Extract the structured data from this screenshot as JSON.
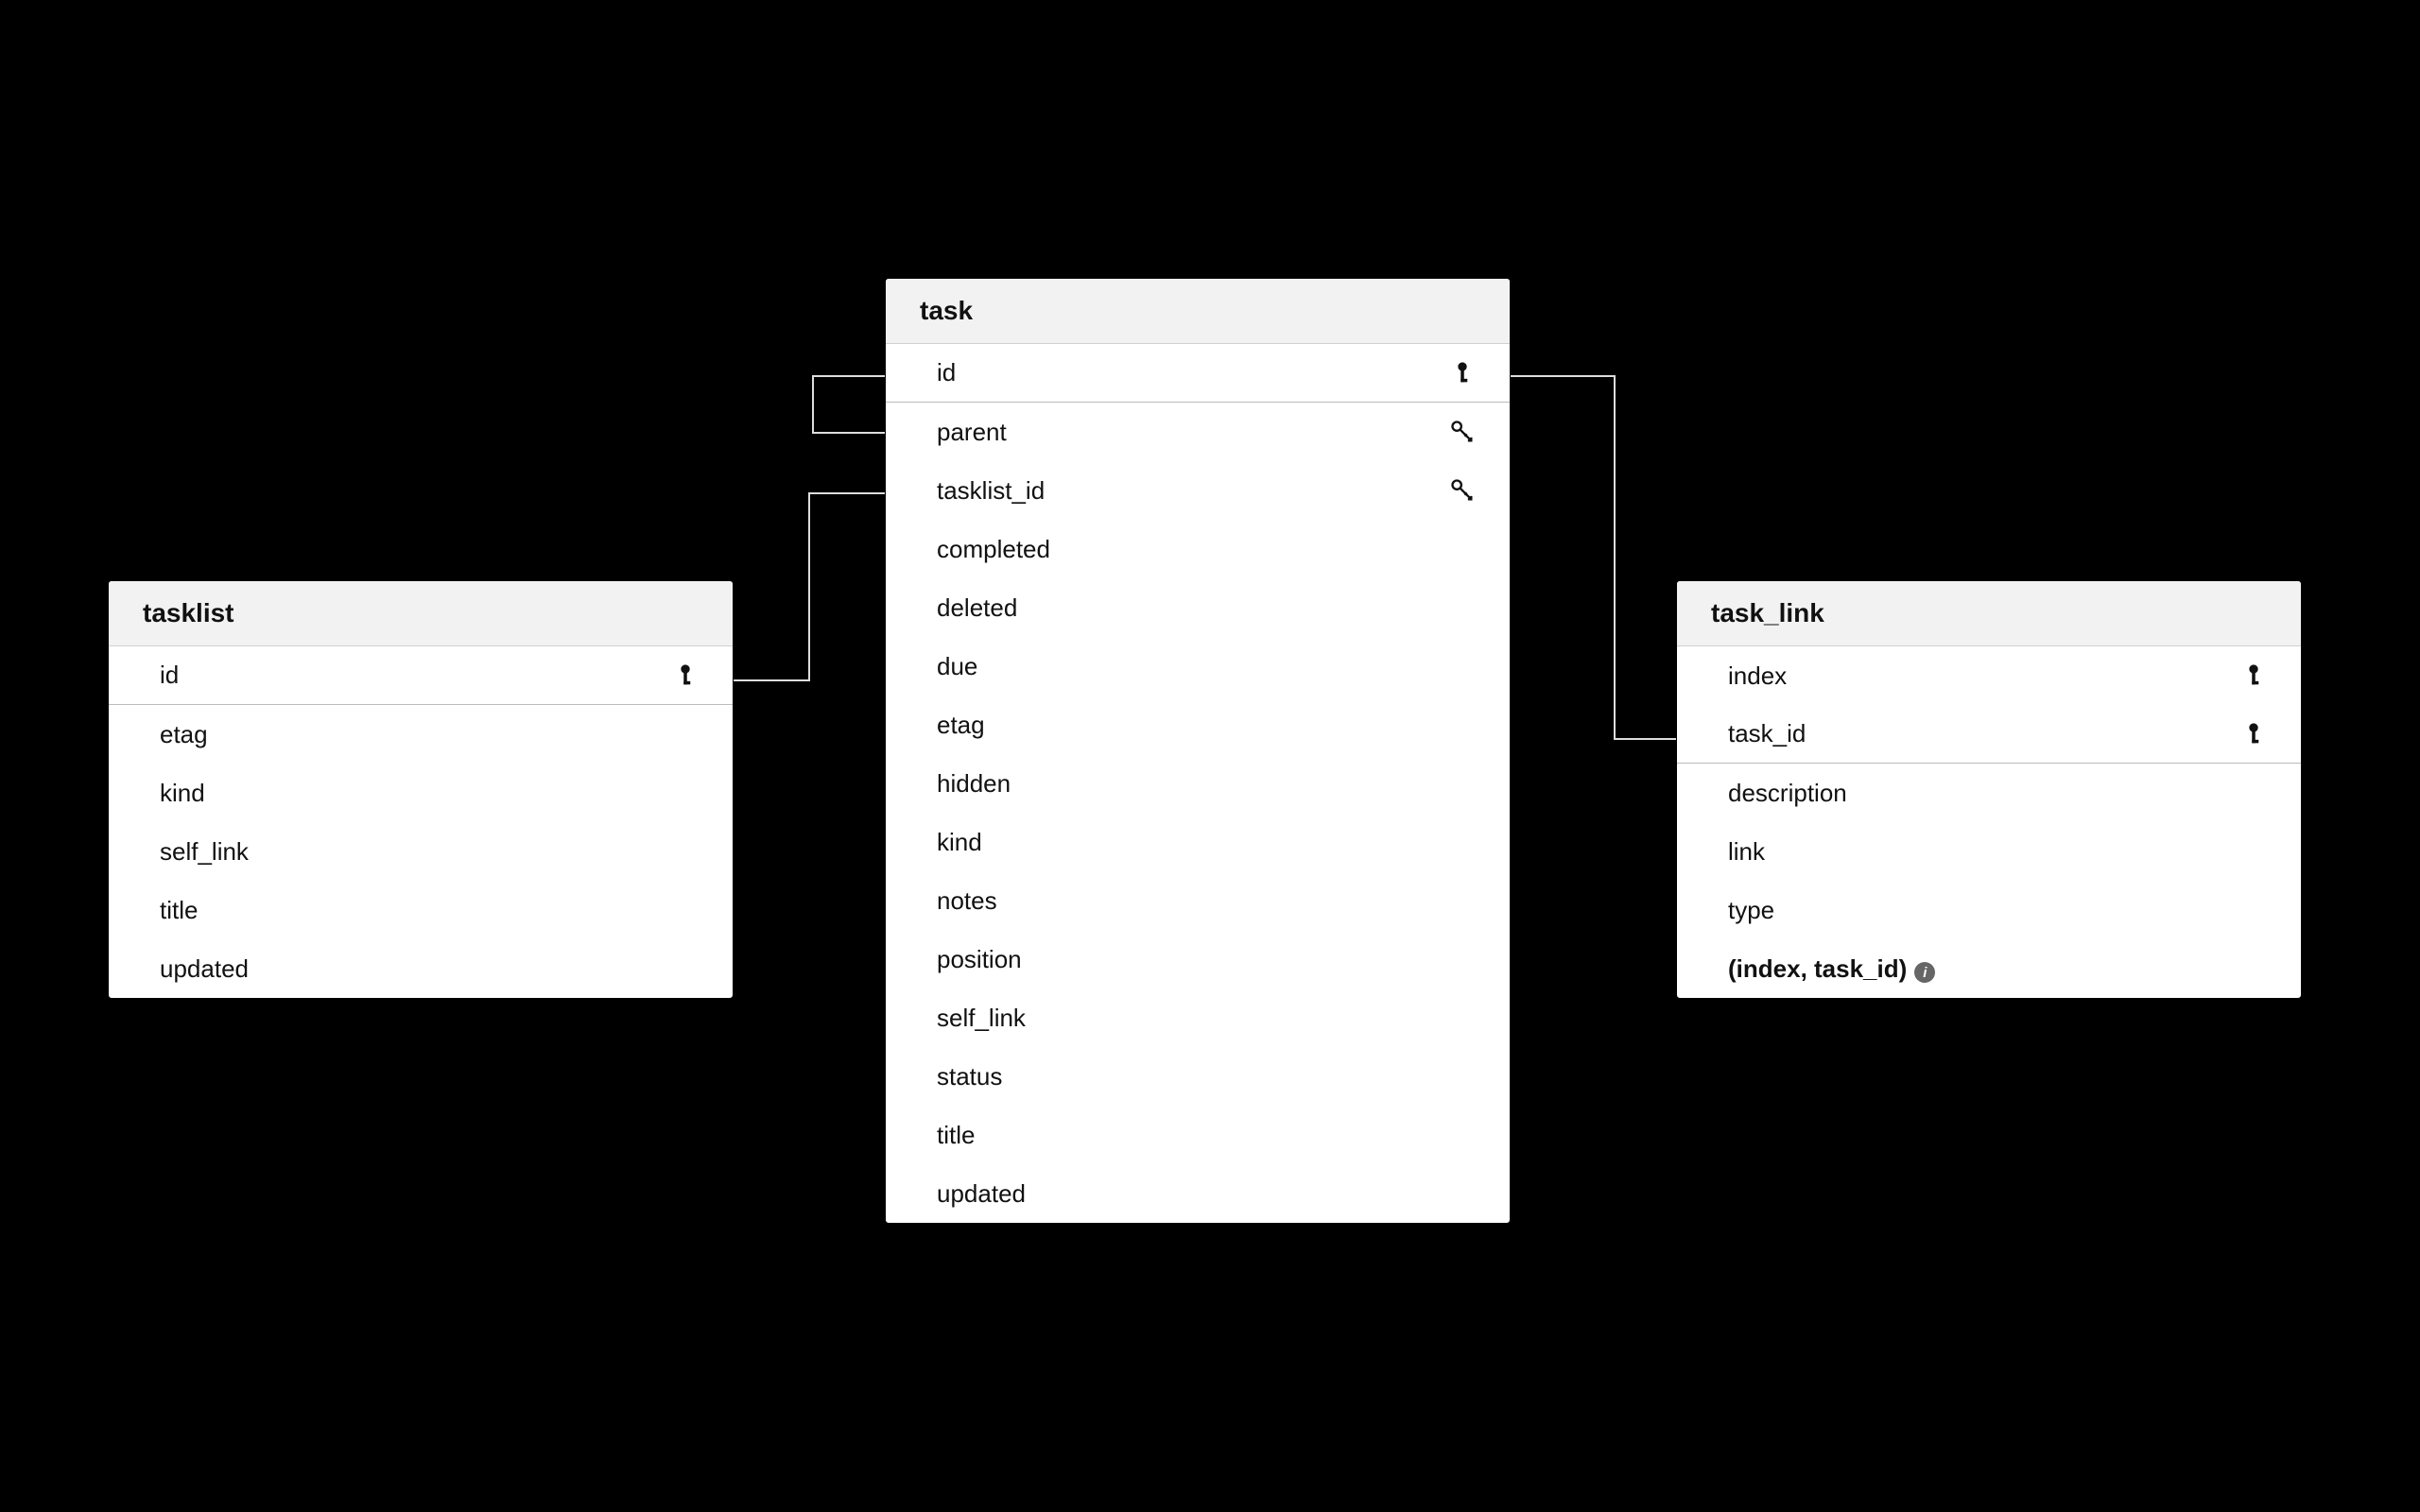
{
  "tables": {
    "tasklist": {
      "name": "tasklist",
      "rows": [
        {
          "label": "id",
          "icon": "pk"
        },
        {
          "label": "etag"
        },
        {
          "label": "kind"
        },
        {
          "label": "self_link"
        },
        {
          "label": "title"
        },
        {
          "label": "updated"
        }
      ]
    },
    "task": {
      "name": "task",
      "rows": [
        {
          "label": "id",
          "icon": "pk"
        },
        {
          "label": "parent",
          "icon": "fk"
        },
        {
          "label": "tasklist_id",
          "icon": "fk"
        },
        {
          "label": "completed"
        },
        {
          "label": "deleted"
        },
        {
          "label": "due"
        },
        {
          "label": "etag"
        },
        {
          "label": "hidden"
        },
        {
          "label": "kind"
        },
        {
          "label": "notes"
        },
        {
          "label": "position"
        },
        {
          "label": "self_link"
        },
        {
          "label": "status"
        },
        {
          "label": "title"
        },
        {
          "label": "updated"
        }
      ]
    },
    "task_link": {
      "name": "task_link",
      "rows": [
        {
          "label": "index",
          "icon": "pk"
        },
        {
          "label": "task_id",
          "icon": "pk"
        },
        {
          "label": "description"
        },
        {
          "label": "link"
        },
        {
          "label": "type"
        },
        {
          "label": "(index, task_id)",
          "composite": true,
          "info": true
        }
      ]
    }
  }
}
